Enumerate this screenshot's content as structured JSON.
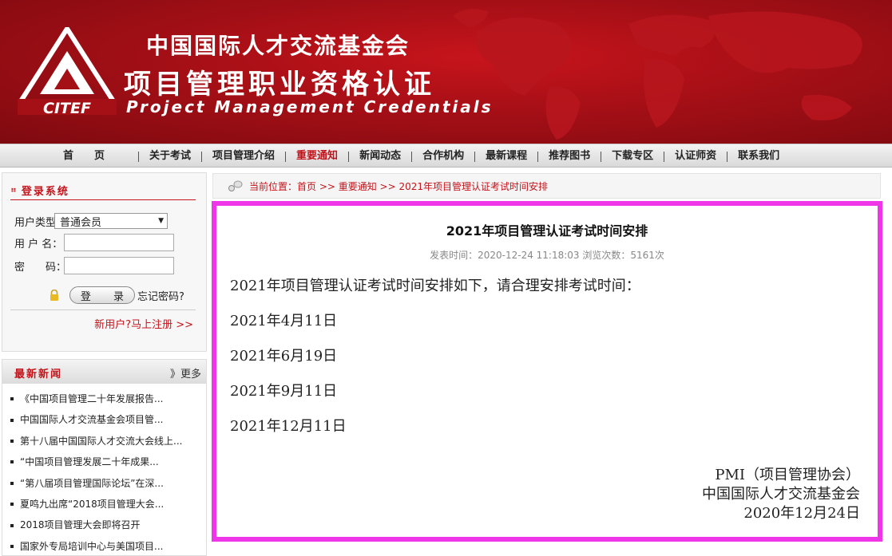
{
  "header": {
    "logo_text": "CITEF",
    "title_cn_org": "中国国际人才交流基金会",
    "title_cn_main": "项目管理职业资格认证",
    "title_en": "Project Management Credentials"
  },
  "nav": {
    "items": [
      {
        "label": "首页",
        "active": false
      },
      {
        "label": "关于考试",
        "active": false
      },
      {
        "label": "项目管理介绍",
        "active": false
      },
      {
        "label": "重要通知",
        "active": true
      },
      {
        "label": "新闻动态",
        "active": false
      },
      {
        "label": "合作机构",
        "active": false
      },
      {
        "label": "最新课程",
        "active": false
      },
      {
        "label": "推荐图书",
        "active": false
      },
      {
        "label": "下载专区",
        "active": false
      },
      {
        "label": "认证师资",
        "active": false
      },
      {
        "label": "联系我们",
        "active": false
      }
    ]
  },
  "login": {
    "heading": "登录系统",
    "user_type_label": "用户类型：",
    "user_type_value": "普通会员",
    "username_label": "用 户 名：",
    "password_label": "密　　码：",
    "login_button": "登 录",
    "forgot_password": "忘记密码?",
    "register_link": "新用户?马上注册 >>"
  },
  "news": {
    "heading": "最新新闻",
    "more": "》更多",
    "items": [
      "《中国项目管理二十年发展报告...",
      "中国国际人才交流基金会项目管...",
      "第十八届中国国际人才交流大会线上...",
      "“中国项目管理发展二十年成果...",
      "“第八届项目管理国际论坛”在深...",
      "夏鸣九出席“2018项目管理大会...",
      "2018项目管理大会即将召开",
      "国家外专局培训中心与美国项目..."
    ]
  },
  "breadcrumb": {
    "text": "当前位置：首页 >> 重要通知 >> 2021年项目管理认证考试时间安排"
  },
  "article": {
    "title": "2021年项目管理认证考试时间安排",
    "meta": "发表时间：2020-12-24 11:18:03  浏览次数：5161次",
    "paragraphs": [
      "2021年项目管理认证考试时间安排如下，请合理安排考试时间：",
      "2021年4月11日",
      "2021年6月19日",
      "2021年9月11日",
      "2021年12月11日"
    ],
    "signature": [
      "PMI（项目管理协会）",
      "中国国际人才交流基金会",
      "2020年12月24日"
    ]
  },
  "colors": {
    "brand_red": "#c4141b",
    "highlight_border": "#ee36e8"
  }
}
